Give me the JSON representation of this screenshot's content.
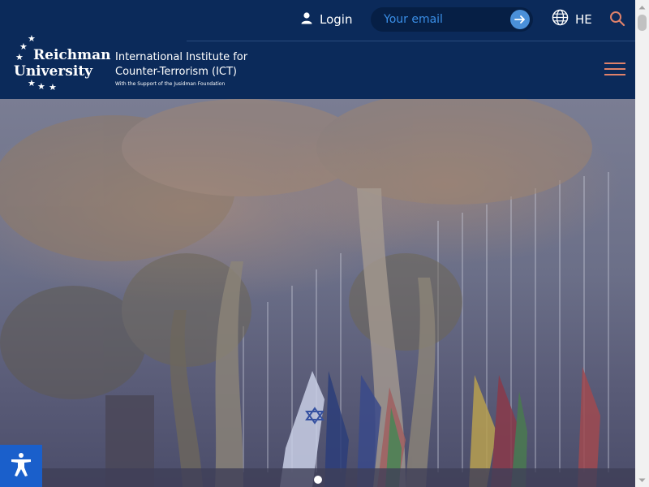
{
  "header": {
    "login_label": "Login",
    "email": {
      "placeholder": "Your email",
      "value": ""
    },
    "language_label": "HE",
    "logo": {
      "line1": "Reichman",
      "line2": "University"
    },
    "institute": {
      "line1": "International Institute for",
      "line2": "Counter-Terrorism (ICT)",
      "support": "With the Support of the Jusidman Foundation"
    }
  },
  "icons": {
    "login": "user-icon",
    "submit": "arrow-right-icon",
    "language": "globe-icon",
    "search": "search-icon",
    "menu": "hamburger-menu-icon",
    "accessibility": "accessibility-icon"
  },
  "colors": {
    "header_bg": "#0b2a5a",
    "accent": "#e0826a",
    "email_bg": "#061f45",
    "email_text": "#3a8ee6",
    "accessibility_bg": "#1a5fcb"
  },
  "carousel": {
    "total_slides": 1,
    "active_slide": 1
  }
}
